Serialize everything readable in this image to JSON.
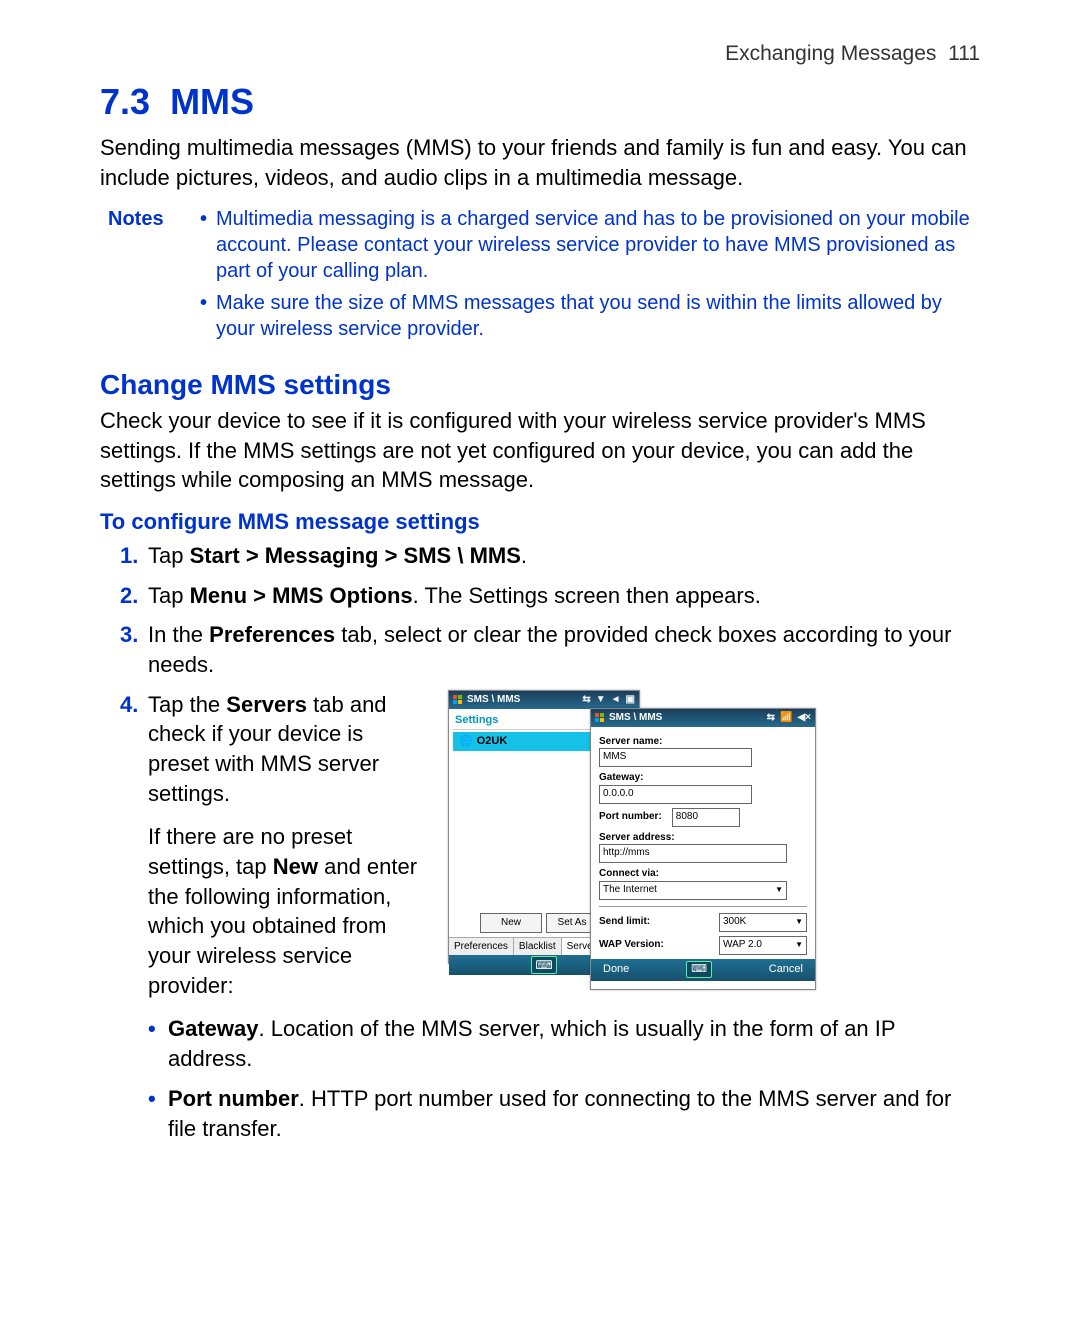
{
  "header": {
    "chapter": "Exchanging Messages",
    "page": "111"
  },
  "section": {
    "number": "7.3",
    "title": "MMS"
  },
  "intro": "Sending multimedia messages (MMS) to your friends and family is fun and easy. You can include pictures, videos, and audio clips in a multimedia message.",
  "notes": {
    "label": "Notes",
    "items": [
      "Multimedia messaging is a charged service and has to be provisioned on your mobile account. Please contact your wireless service provider to have MMS provisioned as part of your calling plan.",
      "Make sure the size of MMS messages that you send is within the limits allowed by your wireless service provider."
    ]
  },
  "subheading": "Change MMS settings",
  "subdesc": "Check your device to see if it is configured with your wireless service provider's MMS settings. If the MMS settings are not yet configured on your device, you can add the settings while composing an MMS message.",
  "confighead": "To configure MMS message settings",
  "steps": {
    "s1": {
      "pre": "Tap ",
      "bold": "Start > Messaging > SMS \\ MMS",
      "post": "."
    },
    "s2": {
      "pre": "Tap ",
      "bold": "Menu > MMS Options",
      "post": ". The Settings screen then appears."
    },
    "s3": {
      "pre": "In the ",
      "bold": "Preferences",
      "post": " tab, select or clear the provided check boxes according to your needs."
    },
    "s4a": {
      "pre": "Tap the ",
      "bold": "Servers",
      "post": " tab and check if your device is preset with MMS server settings."
    },
    "s4b": {
      "pre": "If there are no preset settings, tap ",
      "bold": "New",
      "post": " and enter the following information, which you obtained from your wireless service provider:"
    }
  },
  "screens": {
    "a": {
      "title": "SMS \\ MMS",
      "settings_label": "Settings",
      "server_item": "O2UK",
      "btn_new": "New",
      "btn_setdefault": "Set As D",
      "tabs": [
        "Preferences",
        "Blacklist",
        "Servers"
      ]
    },
    "b": {
      "title": "SMS \\ MMS",
      "server_name_lbl": "Server name:",
      "server_name_val": "MMS",
      "gateway_lbl": "Gateway:",
      "gateway_val": "0.0.0.0",
      "port_lbl": "Port number:",
      "port_val": "8080",
      "server_addr_lbl": "Server address:",
      "server_addr_val": "http://mms",
      "connect_via_lbl": "Connect via:",
      "connect_via_val": "The Internet",
      "send_limit_lbl": "Send limit:",
      "send_limit_val": "300K",
      "wap_ver_lbl": "WAP Version:",
      "wap_ver_val": "WAP 2.0",
      "done": "Done",
      "cancel": "Cancel"
    }
  },
  "defs": {
    "gateway": {
      "bold": "Gateway",
      "text": ". Location of the MMS server, which is usually in the form of an IP address."
    },
    "port": {
      "bold": "Port number",
      "text": ". HTTP port number used for connecting to the MMS server and for file transfer."
    }
  }
}
